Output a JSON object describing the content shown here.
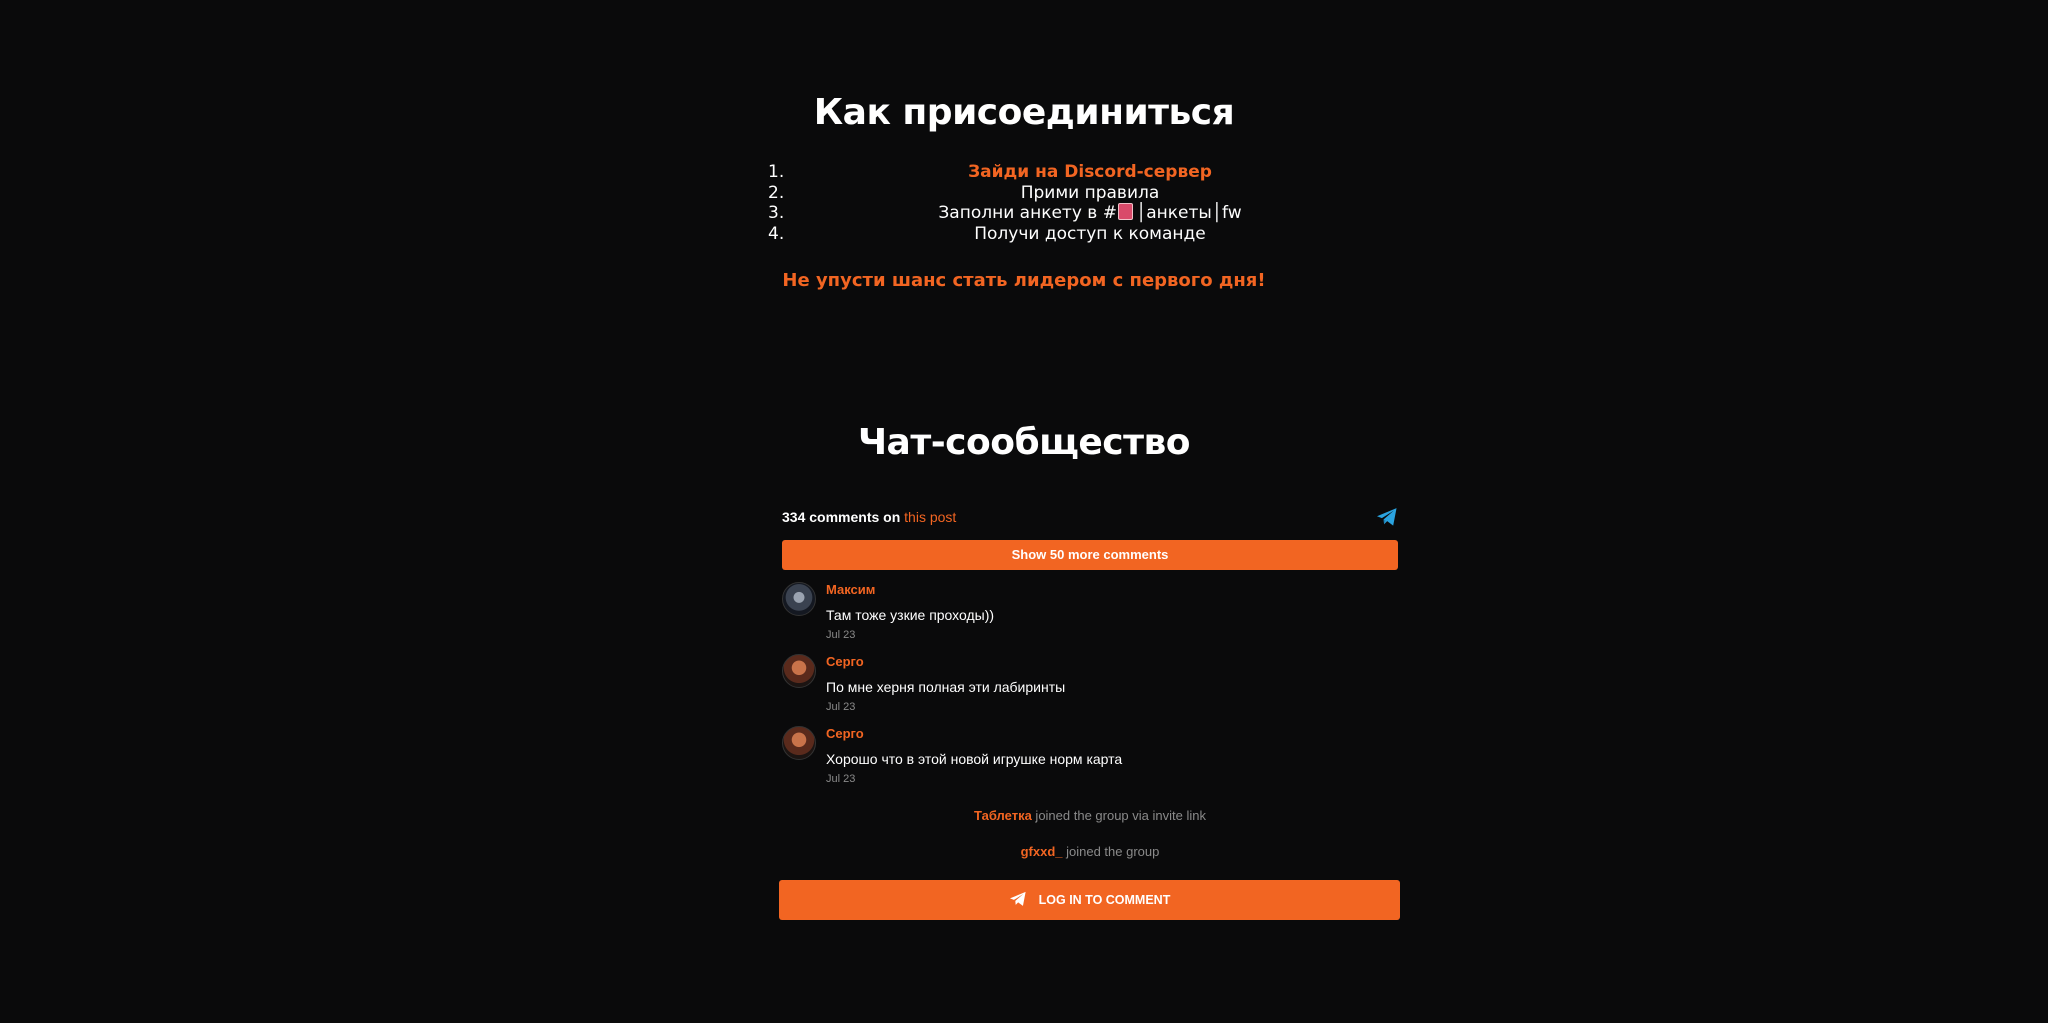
{
  "join": {
    "title": "Как присоединиться",
    "steps": [
      {
        "num": "1.",
        "text": "Зайди на Discord-сервер"
      },
      {
        "num": "2.",
        "text": "Прими правила"
      },
      {
        "num": "3.",
        "text_before": "Заполни анкету в #",
        "text_after": "│анкеты│fw"
      },
      {
        "num": "4.",
        "text": "Получи доступ к команде"
      }
    ],
    "tagline": "Не упусти шанс стать лидером с первого дня!"
  },
  "chat": {
    "title": "Чат-сообщество",
    "header": {
      "count_text": "334 comments on ",
      "post_link": "this post"
    },
    "show_more": "Show 50 more comments",
    "comments": [
      {
        "author": "Максим",
        "text": "Там тоже узкие проходы))",
        "date": "Jul 23"
      },
      {
        "author": "Серго",
        "text": "По мне херня полная эти лабиринты",
        "date": "Jul 23"
      },
      {
        "author": "Серго",
        "text": "Хорошо что в этой новой игрушке норм карта",
        "date": "Jul 23"
      }
    ],
    "service": [
      {
        "who": "Таблетка",
        "action": " joined the group via invite link"
      },
      {
        "who": "gfxxd_",
        "action": " joined the group"
      }
    ],
    "login_label": "LOG IN TO COMMENT"
  },
  "colors": {
    "accent": "#f26522",
    "background": "#0a0a0b",
    "telegram_blue": "#2aa3e0"
  }
}
